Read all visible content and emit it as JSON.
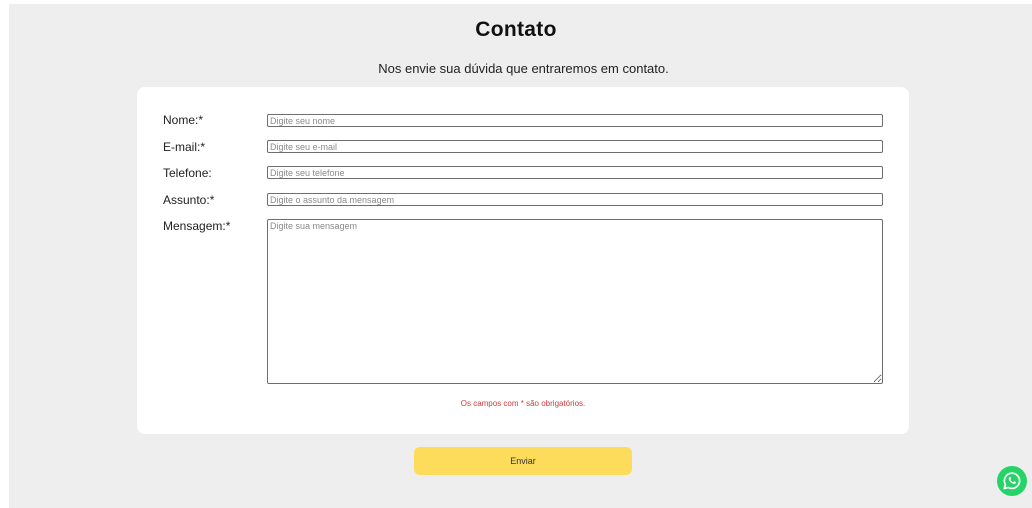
{
  "header": {
    "title": "Contato",
    "subtitle": "Nos envie sua dúvida que entraremos em contato."
  },
  "form": {
    "fields": [
      {
        "label": "Nome:*",
        "placeholder": "Digite seu nome",
        "value": ""
      },
      {
        "label": "E-mail:*",
        "placeholder": "Digite seu e-mail",
        "value": ""
      },
      {
        "label": "Telefone:",
        "placeholder": "Digite seu telefone",
        "value": ""
      },
      {
        "label": "Assunto:*",
        "placeholder": "Digite o assunto da mensagem",
        "value": ""
      }
    ],
    "message": {
      "label": "Mensagem:*",
      "placeholder": "Digite sua mensagem",
      "value": ""
    },
    "required_note": "Os campos com * são obrigatórios.",
    "submit_label": "Enviar"
  },
  "floating": {
    "whatsapp_icon": "whatsapp-icon"
  },
  "colors": {
    "page_background": "#eeeeee",
    "card_background": "#ffffff",
    "button_background": "#fddc5c",
    "required_note": "#d23a3a",
    "whatsapp": "#25d366"
  }
}
